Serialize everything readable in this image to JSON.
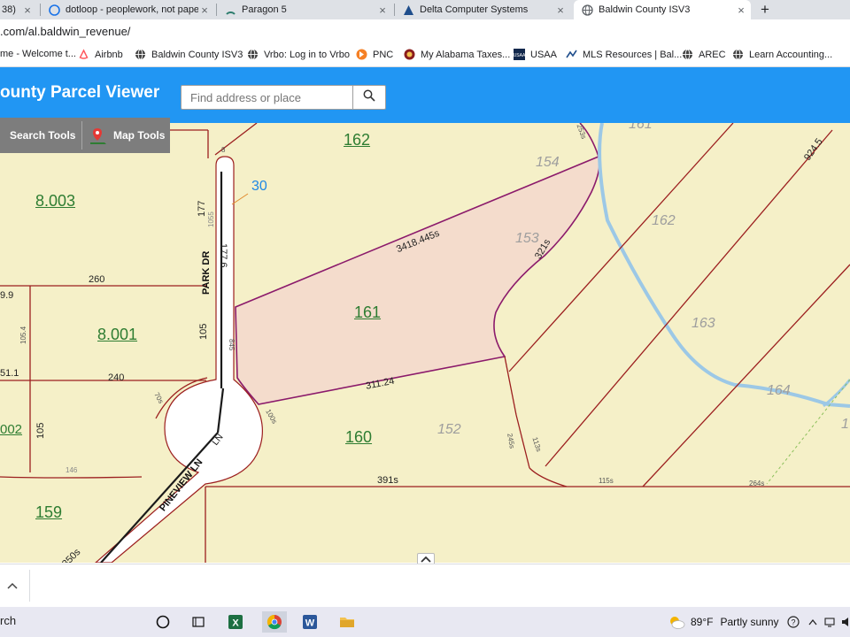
{
  "browser": {
    "tabs": [
      {
        "label": "38)",
        "icon": "mail-icon",
        "active": false
      },
      {
        "label": "dotloop - peoplework, not paper",
        "icon": "dotloop-icon",
        "active": false
      },
      {
        "label": "Paragon 5",
        "icon": "paragon-icon",
        "active": false
      },
      {
        "label": "Delta Computer Systems",
        "icon": "delta-icon",
        "active": false
      },
      {
        "label": "Baldwin County ISV3",
        "icon": "globe-icon",
        "active": true
      }
    ],
    "tab_close_glyph": "×",
    "new_tab_glyph": "+",
    "url": ".com/al.baldwin_revenue/",
    "bookmarks": [
      {
        "label": "me - Welcome t...",
        "icon": "none"
      },
      {
        "label": "Airbnb",
        "icon": "airbnb-icon"
      },
      {
        "label": "Baldwin County ISV3",
        "icon": "globe-icon"
      },
      {
        "label": "Vrbo: Log in to Vrbo",
        "icon": "globe-icon"
      },
      {
        "label": "PNC",
        "icon": "pnc-icon"
      },
      {
        "label": "My Alabama Taxes...",
        "icon": "alabama-icon"
      },
      {
        "label": "USAA",
        "icon": "usaa-icon"
      },
      {
        "label": "MLS Resources | Bal...",
        "icon": "mls-icon"
      },
      {
        "label": "AREC",
        "icon": "globe-icon"
      },
      {
        "label": "Learn Accounting...",
        "icon": "globe-icon"
      }
    ]
  },
  "app": {
    "title": "ounty Parcel Viewer",
    "search_placeholder": "Find address or place",
    "search_value": "",
    "accent_color": "#2196f3",
    "tools": {
      "search_label": "Search Tools",
      "map_label": "Map Tools"
    }
  },
  "map": {
    "colors": {
      "background": "#f5f0c8",
      "parcel_line": "#9c1f1f",
      "selected_fill": "#f4dccc",
      "selected_outline": "#8b1a6b",
      "water": "#9cc8e6",
      "parcel_number": "#2e7d32"
    },
    "parcel_numbers": [
      "162",
      "8.003",
      "8.001",
      "161",
      "160",
      "159",
      "002"
    ],
    "gray_labels": [
      "154",
      "153",
      "162",
      "163",
      "164",
      "152",
      "161",
      "1"
    ],
    "road_labels": {
      "park_dr": "PARK DR",
      "pineview_ln": "PINEVIEW LN",
      "pineview_ct": "LN"
    },
    "dimension_labels": {
      "thirty": "30",
      "d177": "177",
      "d1776": "177.6",
      "d260": "260",
      "d9_9": "9.9",
      "d105_4": "105.4",
      "d105": "105",
      "d51_1": "51.1",
      "d240": "240",
      "d105b": "105",
      "d146": "146",
      "d3418": "3418.445s",
      "d321": "321s",
      "d311": "311.24",
      "d391": "391s",
      "d115": "115s",
      "d264": "264s",
      "d9245": "924.5",
      "d350": "350s",
      "d245": "245s",
      "d113": "113s",
      "d100": "100s",
      "d70": "70s",
      "d845": "845",
      "d1055": "1055",
      "d253": "253s",
      "d8": "8"
    }
  },
  "taskbar": {
    "search_text": "rch",
    "weather_temp": "89°F",
    "weather_text": "Partly sunny",
    "apps": [
      "task-view-icon",
      "excel-icon",
      "chrome-icon",
      "word-icon",
      "file-explorer-icon"
    ]
  }
}
